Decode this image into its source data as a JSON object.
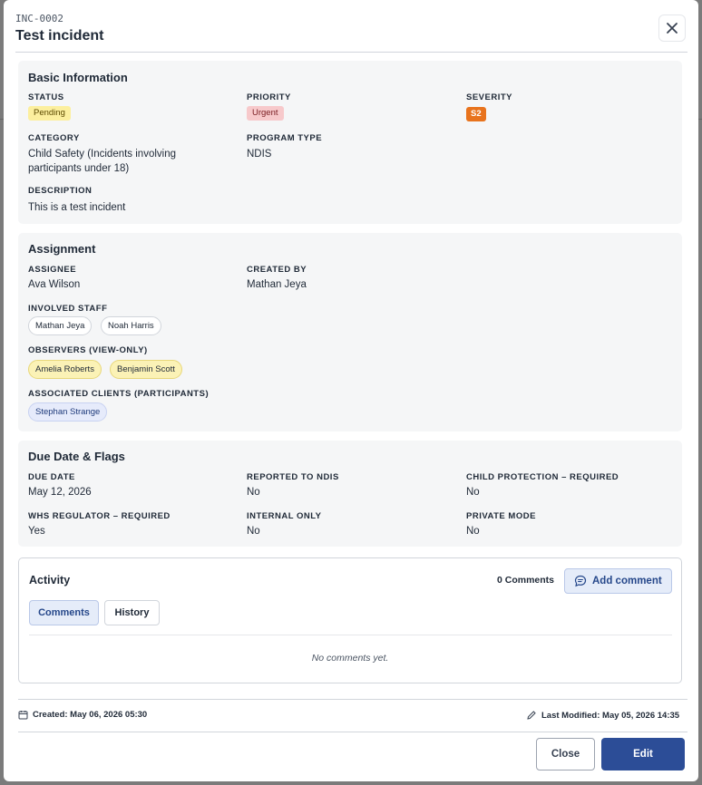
{
  "header": {
    "incident_id": "INC-0002",
    "title": "Test incident",
    "close_icon": "close-icon"
  },
  "basic_info": {
    "title": "Basic Information",
    "status_label": "STATUS",
    "status_value": "Pending",
    "priority_label": "PRIORITY",
    "priority_value": "Urgent",
    "severity_label": "SEVERITY",
    "severity_value": "S2",
    "category_label": "CATEGORY",
    "category_value_line1": "Child Safety (Incidents involving",
    "category_value_line2": "participants under 18)",
    "program_type_label": "PROGRAM TYPE",
    "program_type_value": "NDIS",
    "description_label": "DESCRIPTION",
    "description_value": "This is a test incident"
  },
  "assignment": {
    "title": "Assignment",
    "assignee_label": "ASSIGNEE",
    "assignee_value": "Ava Wilson",
    "created_by_label": "CREATED BY",
    "created_by_value": "Mathan Jeya",
    "involved_staff_label": "INVOLVED STAFF",
    "involved_staff": [
      "Mathan Jeya",
      "Noah Harris"
    ],
    "observers_label": "OBSERVERS (VIEW-ONLY)",
    "observers": [
      "Amelia Roberts",
      "Benjamin Scott"
    ],
    "clients_label": "ASSOCIATED CLIENTS (PARTICIPANTS)",
    "clients": [
      "Stephan Strange"
    ]
  },
  "due_flags": {
    "title": "Due Date & Flags",
    "due_date_label": "DUE DATE",
    "due_date_value": "May 12, 2026",
    "reported_ndis_label": "REPORTED TO NDIS",
    "reported_ndis_value": "No",
    "child_protection_label": "CHILD PROTECTION – REQUIRED",
    "child_protection_value": "No",
    "whs_label": "WHS REGULATOR – REQUIRED",
    "whs_value": "Yes",
    "internal_label": "INTERNAL ONLY",
    "internal_value": "No",
    "private_label": "PRIVATE MODE",
    "private_value": "No"
  },
  "activity": {
    "title": "Activity",
    "count": "0 Comments",
    "add_comment": "Add comment",
    "tabs": [
      "Comments",
      "History"
    ],
    "empty": "No comments yet."
  },
  "meta": {
    "created": "Created: May 06, 2026 05:30",
    "modified": "Last Modified: May 05, 2026 14:35"
  },
  "footer": {
    "close": "Close",
    "edit": "Edit"
  },
  "colors": {
    "primary": "#2c4d97",
    "severity": "#e8731d",
    "pending": "#fcef9e",
    "urgent": "#f7c9cb"
  }
}
